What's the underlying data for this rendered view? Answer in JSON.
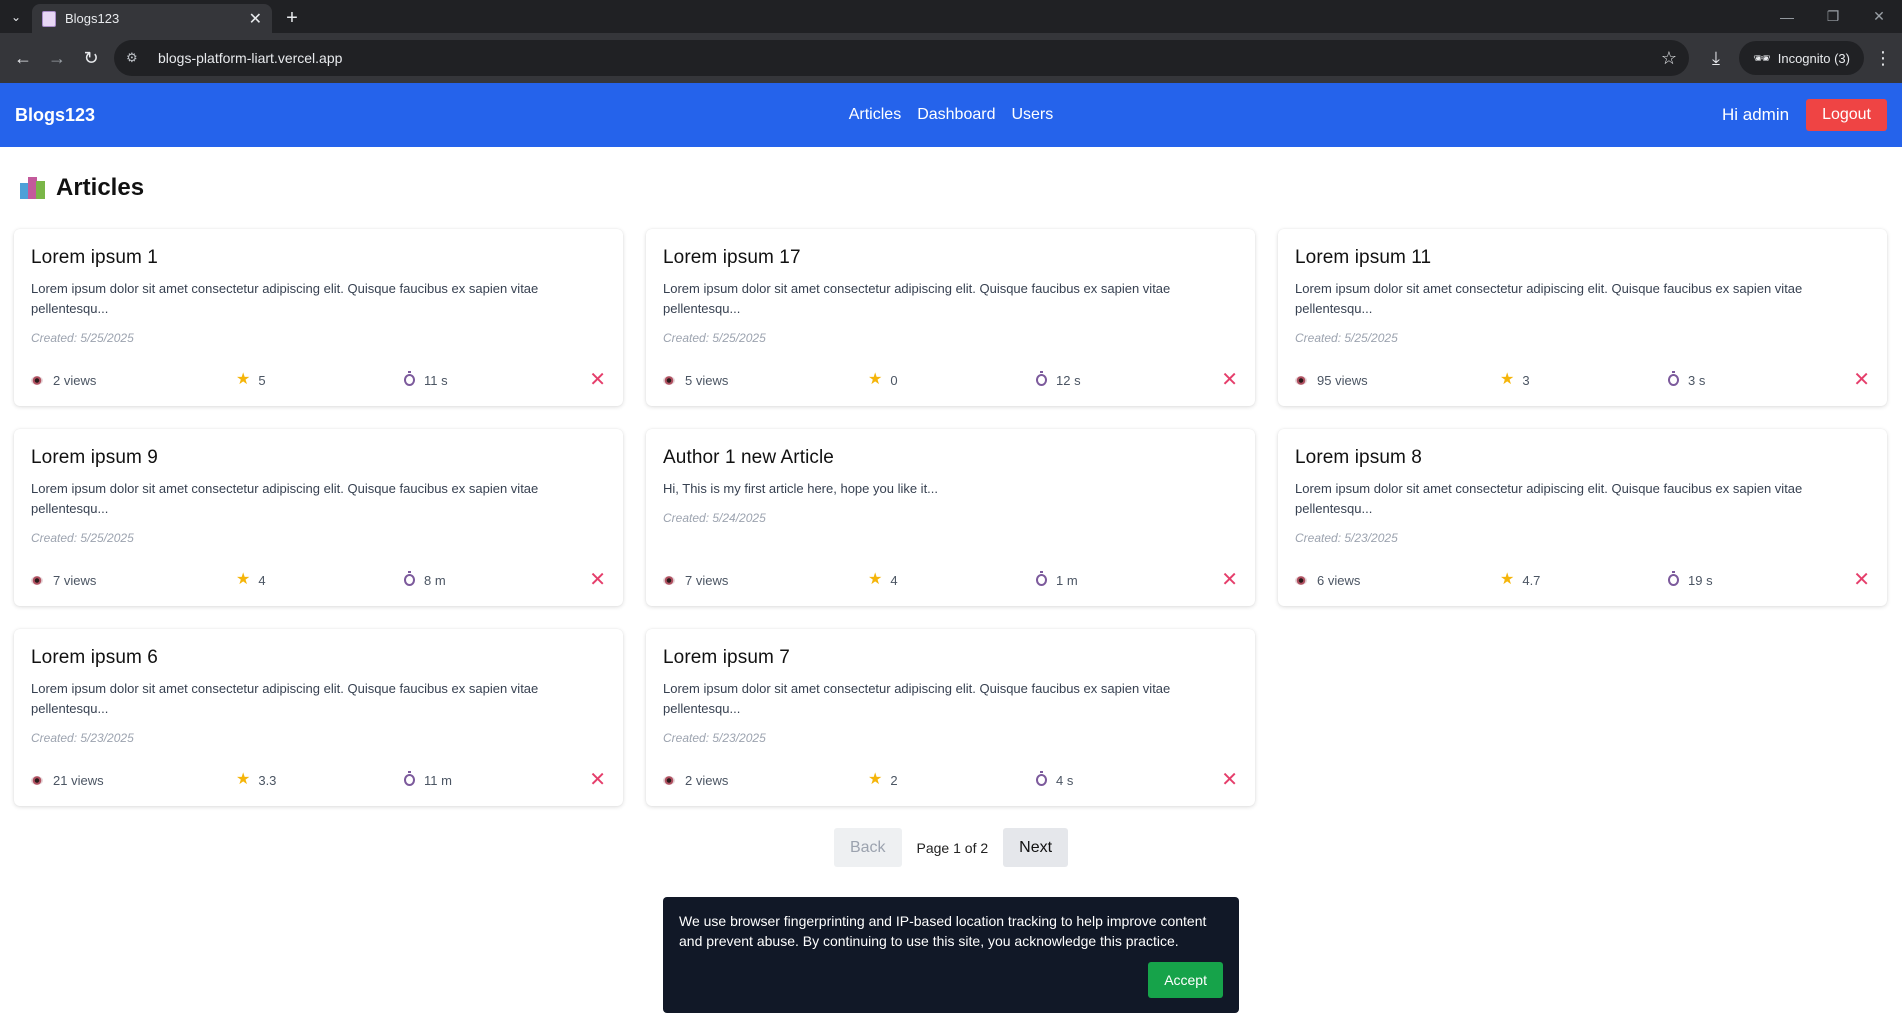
{
  "browser": {
    "tab_title": "Blogs123",
    "url": "blogs-platform-liart.vercel.app",
    "incognito_label": "Incognito (3)"
  },
  "nav": {
    "brand": "Blogs123",
    "links": [
      "Articles",
      "Dashboard",
      "Users"
    ],
    "greeting": "Hi admin",
    "logout": "Logout"
  },
  "page": {
    "title": "Articles"
  },
  "articles": [
    {
      "title": "Lorem ipsum 1",
      "excerpt": "Lorem ipsum dolor sit amet consectetur adipiscing elit. Quisque faucibus ex sapien vitae pellentesqu...",
      "created": "Created: 5/25/2025",
      "views": "2 views",
      "rating": "5",
      "time": "11 s"
    },
    {
      "title": "Lorem ipsum 17",
      "excerpt": "Lorem ipsum dolor sit amet consectetur adipiscing elit. Quisque faucibus ex sapien vitae pellentesqu...",
      "created": "Created: 5/25/2025",
      "views": "5 views",
      "rating": "0",
      "time": "12 s"
    },
    {
      "title": "Lorem ipsum 11",
      "excerpt": "Lorem ipsum dolor sit amet consectetur adipiscing elit. Quisque faucibus ex sapien vitae pellentesqu...",
      "created": "Created: 5/25/2025",
      "views": "95 views",
      "rating": "3",
      "time": "3 s"
    },
    {
      "title": "Lorem ipsum 9",
      "excerpt": "Lorem ipsum dolor sit amet consectetur adipiscing elit. Quisque faucibus ex sapien vitae pellentesqu...",
      "created": "Created: 5/25/2025",
      "views": "7 views",
      "rating": "4",
      "time": "8 m"
    },
    {
      "title": "Author 1 new Article",
      "excerpt": "Hi, This is my first article here, hope you like it...",
      "created": "Created: 5/24/2025",
      "views": "7 views",
      "rating": "4",
      "time": "1 m"
    },
    {
      "title": "Lorem ipsum 8",
      "excerpt": "Lorem ipsum dolor sit amet consectetur adipiscing elit. Quisque faucibus ex sapien vitae pellentesqu...",
      "created": "Created: 5/23/2025",
      "views": "6 views",
      "rating": "4.7",
      "time": "19 s"
    },
    {
      "title": "Lorem ipsum 6",
      "excerpt": "Lorem ipsum dolor sit amet consectetur adipiscing elit. Quisque faucibus ex sapien vitae pellentesqu...",
      "created": "Created: 5/23/2025",
      "views": "21 views",
      "rating": "3.3",
      "time": "11 m"
    },
    {
      "title": "Lorem ipsum 7",
      "excerpt": "Lorem ipsum dolor sit amet consectetur adipiscing elit. Quisque faucibus ex sapien vitae pellentesqu...",
      "created": "Created: 5/23/2025",
      "views": "2 views",
      "rating": "2",
      "time": "4 s"
    }
  ],
  "pagination": {
    "back": "Back",
    "info": "Page 1 of 2",
    "next": "Next"
  },
  "cookie": {
    "message": "We use browser fingerprinting and IP-based location tracking to help improve content and prevent abuse. By continuing to use this site, you acknowledge this practice.",
    "accept": "Accept"
  },
  "icons": {
    "views": "eye-icon",
    "rating": "star-icon",
    "time": "stopwatch-icon",
    "delete": "close-x-icon"
  },
  "colors": {
    "navbar": "#2563eb",
    "logout": "#ef4444",
    "accept": "#16a34a",
    "delete": "#e53e6b",
    "cookie_bg": "#111827"
  }
}
